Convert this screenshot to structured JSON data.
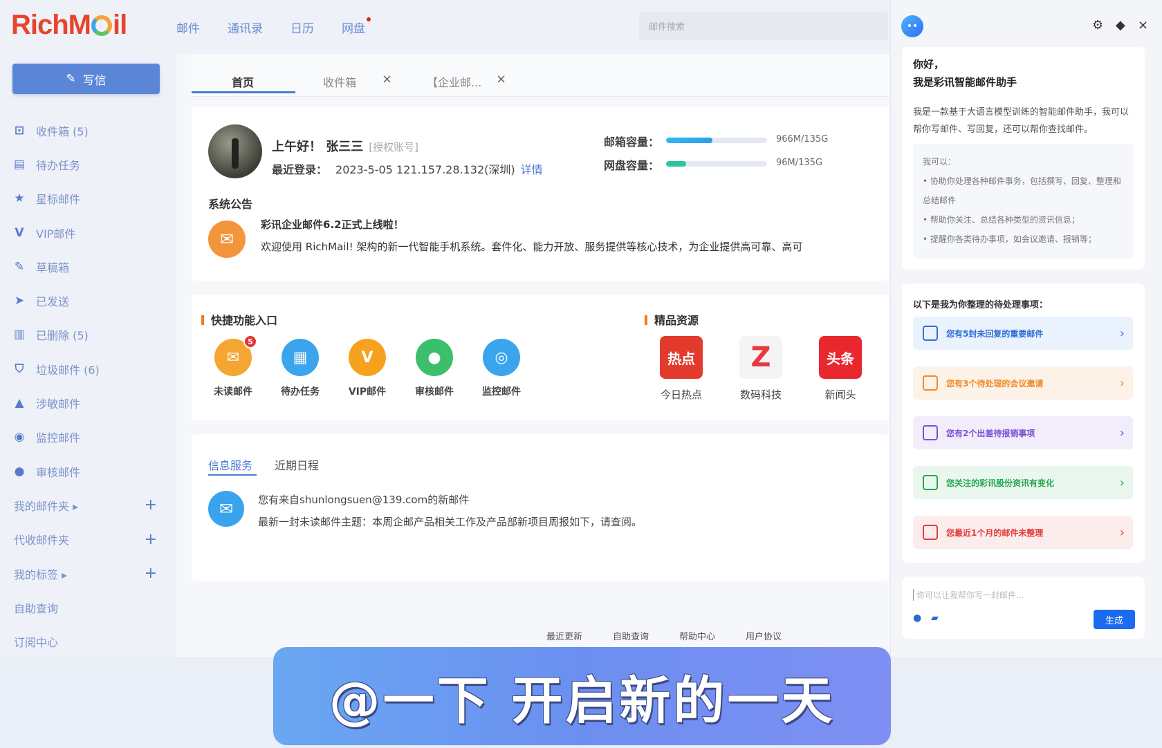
{
  "app": {
    "logo": "RichMail"
  },
  "nav": {
    "items": [
      "邮件",
      "通讯录",
      "日历",
      "网盘"
    ]
  },
  "search": {
    "placeholder": "邮件搜索"
  },
  "sidebar": {
    "compose_label": "写信",
    "items": [
      {
        "label": "收件箱 (5)",
        "icon": "inbox-icon",
        "glyph": "⊡"
      },
      {
        "label": "待办任务",
        "icon": "task-icon",
        "glyph": "▤"
      },
      {
        "label": "星标邮件",
        "icon": "star-icon",
        "glyph": "★"
      },
      {
        "label": "VIP邮件",
        "icon": "vip-icon",
        "glyph": "V"
      },
      {
        "label": "草稿箱",
        "icon": "draft-icon",
        "glyph": "✎"
      },
      {
        "label": "已发送",
        "icon": "send-icon",
        "glyph": "➤"
      },
      {
        "label": "已删除 (5)",
        "icon": "trash-icon",
        "glyph": "▥"
      },
      {
        "label": "垃圾邮件 (6)",
        "icon": "spam-icon",
        "glyph": "⛉"
      },
      {
        "label": "涉敏邮件",
        "icon": "warning-icon",
        "glyph": "▲"
      },
      {
        "label": "监控邮件",
        "icon": "monitor-icon",
        "glyph": "◉"
      },
      {
        "label": "审核邮件",
        "icon": "user-icon",
        "glyph": "●"
      }
    ],
    "groups": [
      {
        "label": "我的邮件夹 ▸",
        "has_add": true
      },
      {
        "label": "代收邮件夹",
        "has_add": true
      },
      {
        "label": "我的标签 ▸",
        "has_add": true
      },
      {
        "label": "自助查询",
        "has_add": false
      },
      {
        "label": "订阅中心",
        "has_add": false
      }
    ]
  },
  "tabs": [
    {
      "label": "首页",
      "active": true
    },
    {
      "label": "收件箱",
      "closable": true
    },
    {
      "label": "【企业邮...",
      "closable": true
    }
  ],
  "profile": {
    "greeting": "上午好！ 张三三",
    "auth": "[授权账号]",
    "last_login_label": "最近登录：",
    "last_login_value": "2023-5-05   121.157.28.132(深圳)",
    "detail_link": "详情",
    "mailbox_label": "邮箱容量：",
    "mailbox_value": "966M/135G",
    "mailbox_ratio": 0.46,
    "disk_label": "网盘容量：",
    "disk_value": "96M/135G",
    "disk_ratio": 0.2
  },
  "announcement": {
    "section": "系统公告",
    "title": "彩讯企业邮件6.2正式上线啦！",
    "body": "欢迎使用 RichMail! 架构的新一代智能手机系统。套件化、能力开放、服务提供等核心技术，为企业提供高可靠、高可"
  },
  "quick": {
    "section": "快捷功能入口",
    "items": [
      {
        "label": "未读邮件",
        "color": "#f5a531",
        "glyph": "✉",
        "badge": "5",
        "icon": "unread-mail-icon"
      },
      {
        "label": "待办任务",
        "color": "#3aa4ec",
        "glyph": "▦",
        "icon": "todo-icon"
      },
      {
        "label": "VIP邮件",
        "color": "#f7a21e",
        "glyph": "V",
        "icon": "vip-mail-icon"
      },
      {
        "label": "审核邮件",
        "color": "#3cbf6d",
        "glyph": "●",
        "icon": "audit-icon"
      },
      {
        "label": "监控邮件",
        "color": "#3aa4ec",
        "glyph": "◎",
        "icon": "monitor-mail-icon"
      }
    ]
  },
  "resources": {
    "section": "精品资源",
    "items": [
      {
        "label": "今日热点",
        "color": "#e23b2e",
        "glyph": "热点",
        "icon": "hot-news-icon"
      },
      {
        "label": "数码科技",
        "color": "#f4f4f4",
        "glyph": "Z",
        "icon": "tech-icon"
      },
      {
        "label": "新闻头",
        "color": "#e8282e",
        "glyph": "头条",
        "icon": "headline-icon"
      }
    ]
  },
  "info": {
    "tabs": [
      "信息服务",
      "近期日程"
    ],
    "line1": "您有来自shunlongsuen@139.com的新邮件",
    "line2": "最新一封未读邮件主题：本周企邮产品相关工作及产品部新项目周报如下，请查阅。"
  },
  "footer": {
    "links": [
      "最近更新",
      "自助查询",
      "帮助中心",
      "用户协议"
    ]
  },
  "assistant": {
    "hello": "你好，",
    "intro_title": "我是彩讯智能邮件助手",
    "intro": "我是一款基于大语言模型训练的智能邮件助手，我可以帮你写邮件、写回复，还可以帮你查找邮件。",
    "can_title": "我可以：",
    "can": [
      "• 协助你处理各种邮件事务，包括撰写、回复、整理和总结邮件",
      "• 帮助你关注、总结各种类型的资讯信息；",
      "• 提醒你各类待办事项，如会议邀请、报销等；"
    ],
    "todo_title": "以下是我为你整理的待处理事项：",
    "todos": [
      {
        "label": "您有5封未回复的重要邮件",
        "color": "#2f6fd6",
        "bg": "#eaf2fd",
        "icon": "mail-todo-icon"
      },
      {
        "label": "您有3个待处理的会议邀请",
        "color": "#f08a2a",
        "bg": "#fdf2e8",
        "icon": "meeting-icon"
      },
      {
        "label": "您有2个出差待报销事项",
        "color": "#7b4fd3",
        "bg": "#f1edfb",
        "icon": "travel-icon"
      },
      {
        "label": "您关注的彩讯股份资讯有变化",
        "color": "#27a74f",
        "bg": "#e9f7ee",
        "icon": "news-icon"
      },
      {
        "label": "您最近1个月的邮件未整理",
        "color": "#e23c3c",
        "bg": "#fdecec",
        "icon": "archive-icon"
      }
    ],
    "input_placeholder": "你可以让我帮你写一封邮件...",
    "generate_label": "生成"
  },
  "caption": "@一下 开启新的一天"
}
